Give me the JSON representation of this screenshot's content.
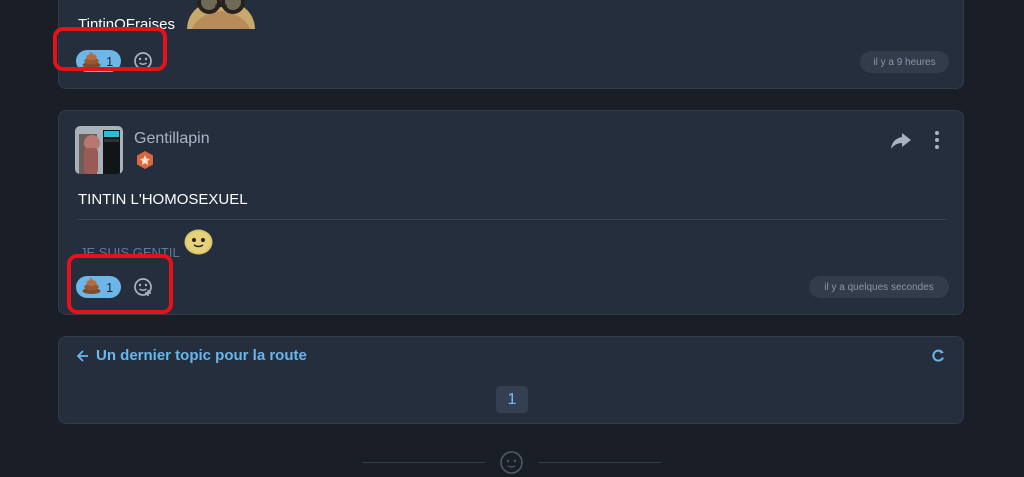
{
  "posts": [
    {
      "username": "TintinOFraises",
      "reaction": {
        "emoji": "poop",
        "count": "1"
      },
      "timestamp": "il y a 9 heures"
    },
    {
      "author": "Gentillapin",
      "message": "TINTIN L'HOMOSEXUEL",
      "signature": "JE SUIS GENTIL",
      "reaction": {
        "emoji": "poop",
        "count": "1"
      },
      "timestamp": "il y a quelques secondes"
    }
  ],
  "topic_nav": {
    "link": "Un dernier topic pour la route",
    "current_page": "1"
  },
  "colors": {
    "background": "#1a1f27",
    "card": "#252e3c",
    "accent": "#67b6ec",
    "highlight": "#e5121b",
    "reaction": "#6db7e8"
  },
  "icons": [
    "poop-icon",
    "add-reaction-icon",
    "share-icon",
    "more-icon",
    "arrow-left-icon",
    "refresh-icon",
    "smiley-icon"
  ]
}
